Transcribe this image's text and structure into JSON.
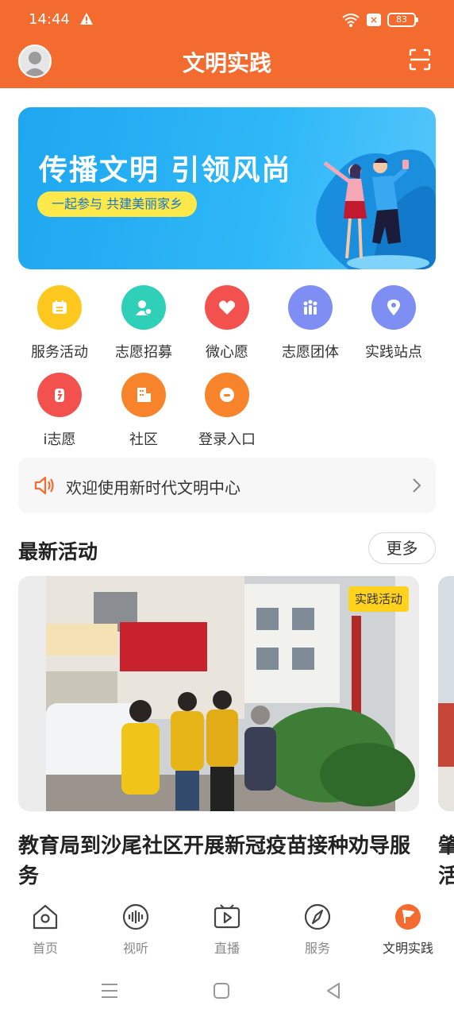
{
  "status": {
    "time": "14:44",
    "battery": "83"
  },
  "header": {
    "title": "文明实践"
  },
  "banner": {
    "title": "传播文明 引领风尚",
    "subtitle": "一起参与 共建美丽家乡"
  },
  "grid": {
    "items": [
      {
        "label": "服务活动",
        "icon": "calendar-icon",
        "color": "#ffc81e"
      },
      {
        "label": "志愿招募",
        "icon": "user-add-icon",
        "color": "#2fcfb8"
      },
      {
        "label": "微心愿",
        "icon": "heart-icon",
        "color": "#f3514e"
      },
      {
        "label": "志愿团体",
        "icon": "group-icon",
        "color": "#7e8ef2"
      },
      {
        "label": "实践站点",
        "icon": "location-icon",
        "color": "#7e8ef2"
      },
      {
        "label": "i志愿",
        "icon": "i-volunteer-icon",
        "color": "#f3514e"
      },
      {
        "label": "社区",
        "icon": "building-icon",
        "color": "#f7842a"
      },
      {
        "label": "登录入口",
        "icon": "login-icon",
        "color": "#f7842a"
      }
    ]
  },
  "notice": {
    "text": "欢迎使用新时代文明中心"
  },
  "section": {
    "title": "最新活动",
    "more_label": "更多"
  },
  "activity": {
    "tag": "实践活动",
    "title": "教育局到沙尾社区开展新冠疫苗接种劝导服务",
    "peek_title": "肇活"
  },
  "tabs": [
    {
      "label": "首页",
      "icon": "home-icon"
    },
    {
      "label": "视听",
      "icon": "audio-icon"
    },
    {
      "label": "直播",
      "icon": "video-icon"
    },
    {
      "label": "服务",
      "icon": "compass-icon"
    },
    {
      "label": "文明实践",
      "icon": "flag-icon",
      "active": true
    }
  ],
  "colors": {
    "accent": "#f36b2f",
    "banner": "#2fb8f7",
    "tag": "#ffd21d"
  }
}
